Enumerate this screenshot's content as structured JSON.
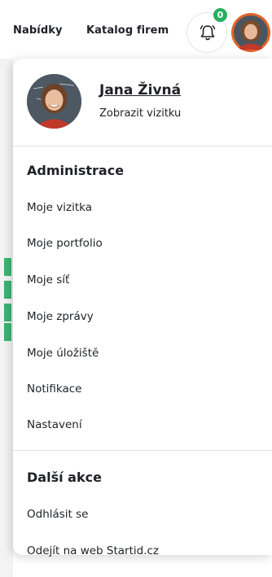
{
  "nav": {
    "links": [
      "Nabídky",
      "Katalog firem"
    ],
    "notification_count": "0",
    "bell_icon": "bell-icon"
  },
  "profile": {
    "name": "Jana Živná",
    "view_card": "Zobrazit vizitku"
  },
  "admin": {
    "title": "Administrace",
    "items": [
      "Moje vizitka",
      "Moje portfolio",
      "Moje síť",
      "Moje zprávy",
      "Moje úložiště",
      "Notifikace",
      "Nastavení"
    ]
  },
  "more": {
    "title": "Další akce",
    "items": [
      "Odhlásit se",
      "Odejít na web Startid.cz"
    ]
  },
  "colors": {
    "badge": "#27ae60",
    "avatar_ring": "#e0662a"
  }
}
